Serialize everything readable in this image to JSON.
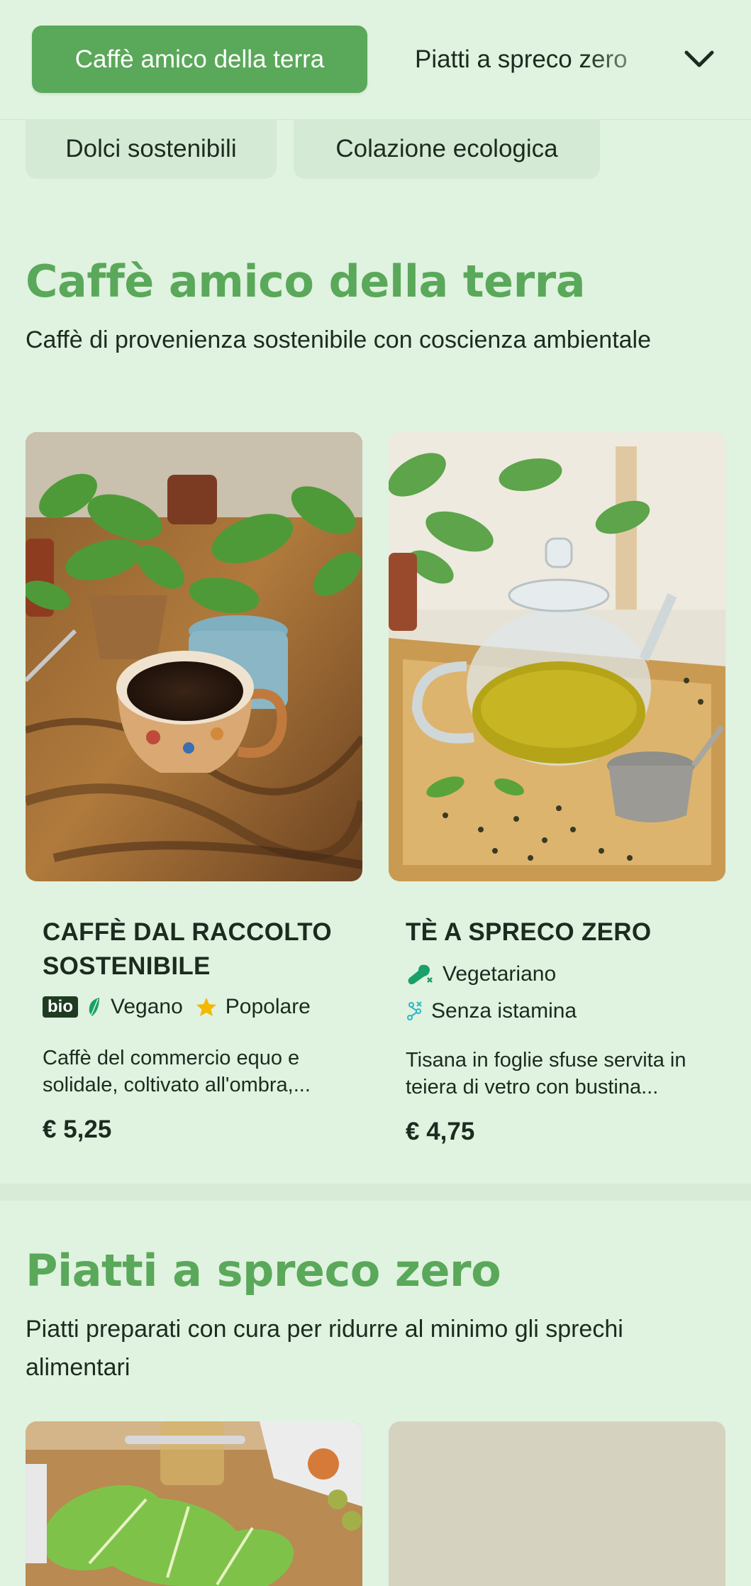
{
  "nav": {
    "active_label": "Caffè amico della terra",
    "second_label": "Piatti a spreco zero",
    "chips": [
      "Dolci sostenibili",
      "Colazione ecologica"
    ]
  },
  "sections": [
    {
      "title": "Caffè amico della terra",
      "description": "Caffè di provenienza sostenibile con coscienza ambientale",
      "items": [
        {
          "name": "CAFFÈ DAL RACCOLTO SOSTENIBILE",
          "tags": {
            "bio": "bio",
            "vegan": "Vegano",
            "popular": "Popolare"
          },
          "description": "Caffè del commercio equo e solidale, coltivato all'ombra,...",
          "price": "€ 5,25"
        },
        {
          "name": "TÈ A SPRECO ZERO",
          "tags": {
            "vegetarian": "Vegetariano",
            "histamine": "Senza istamina"
          },
          "description": "Tisana in foglie sfuse servita in teiera di vetro con bustina...",
          "price": "€ 4,75"
        }
      ]
    },
    {
      "title": "Piatti a spreco zero",
      "description": "Piatti preparati con cura per ridurre al minimo gli sprechi alimentari"
    }
  ],
  "colors": {
    "background": "#e0f2e0",
    "accent": "#5aa85a",
    "text": "#1c2b1f",
    "tag_green": "#1aa06a",
    "star": "#f2b900"
  }
}
